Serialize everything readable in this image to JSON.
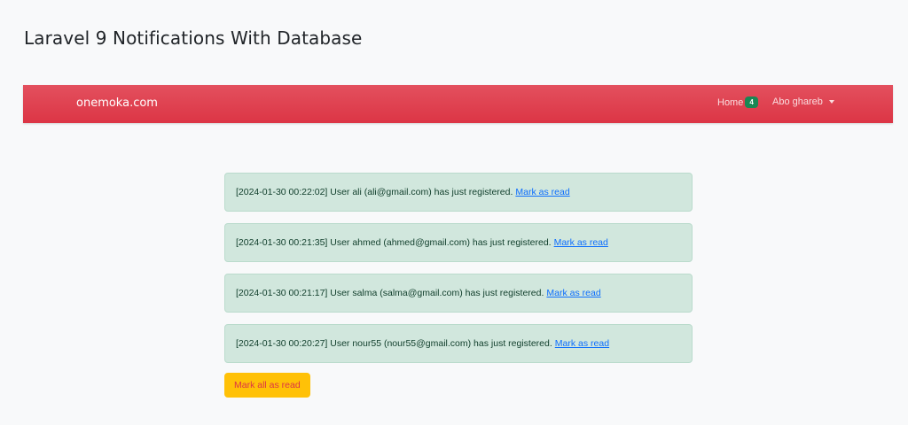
{
  "page": {
    "title": "Laravel 9 Notifications With Database"
  },
  "navbar": {
    "brand": "onemoka.com",
    "home_label": "Home",
    "home_badge": "4",
    "user_label": "Abo ghareb",
    "colors": {
      "background": "#dc3545",
      "badge": "#198754"
    }
  },
  "notifications": [
    {
      "message": "[2024-01-30 00:22:02] User ali (ali@gmail.com) has just registered.",
      "action": "Mark as read"
    },
    {
      "message": "[2024-01-30 00:21:35] User ahmed (ahmed@gmail.com) has just registered.",
      "action": "Mark as read"
    },
    {
      "message": "[2024-01-30 00:21:17] User salma (salma@gmail.com) has just registered.",
      "action": "Mark as read"
    },
    {
      "message": "[2024-01-30 00:20:27] User nour55 (nour55@gmail.com) has just registered.",
      "action": "Mark as read"
    }
  ],
  "mark_all_label": "Mark all as read",
  "colors": {
    "alert_background": "#d1e7dd",
    "link": "#0d6efd",
    "warning_button": "#ffc107"
  }
}
